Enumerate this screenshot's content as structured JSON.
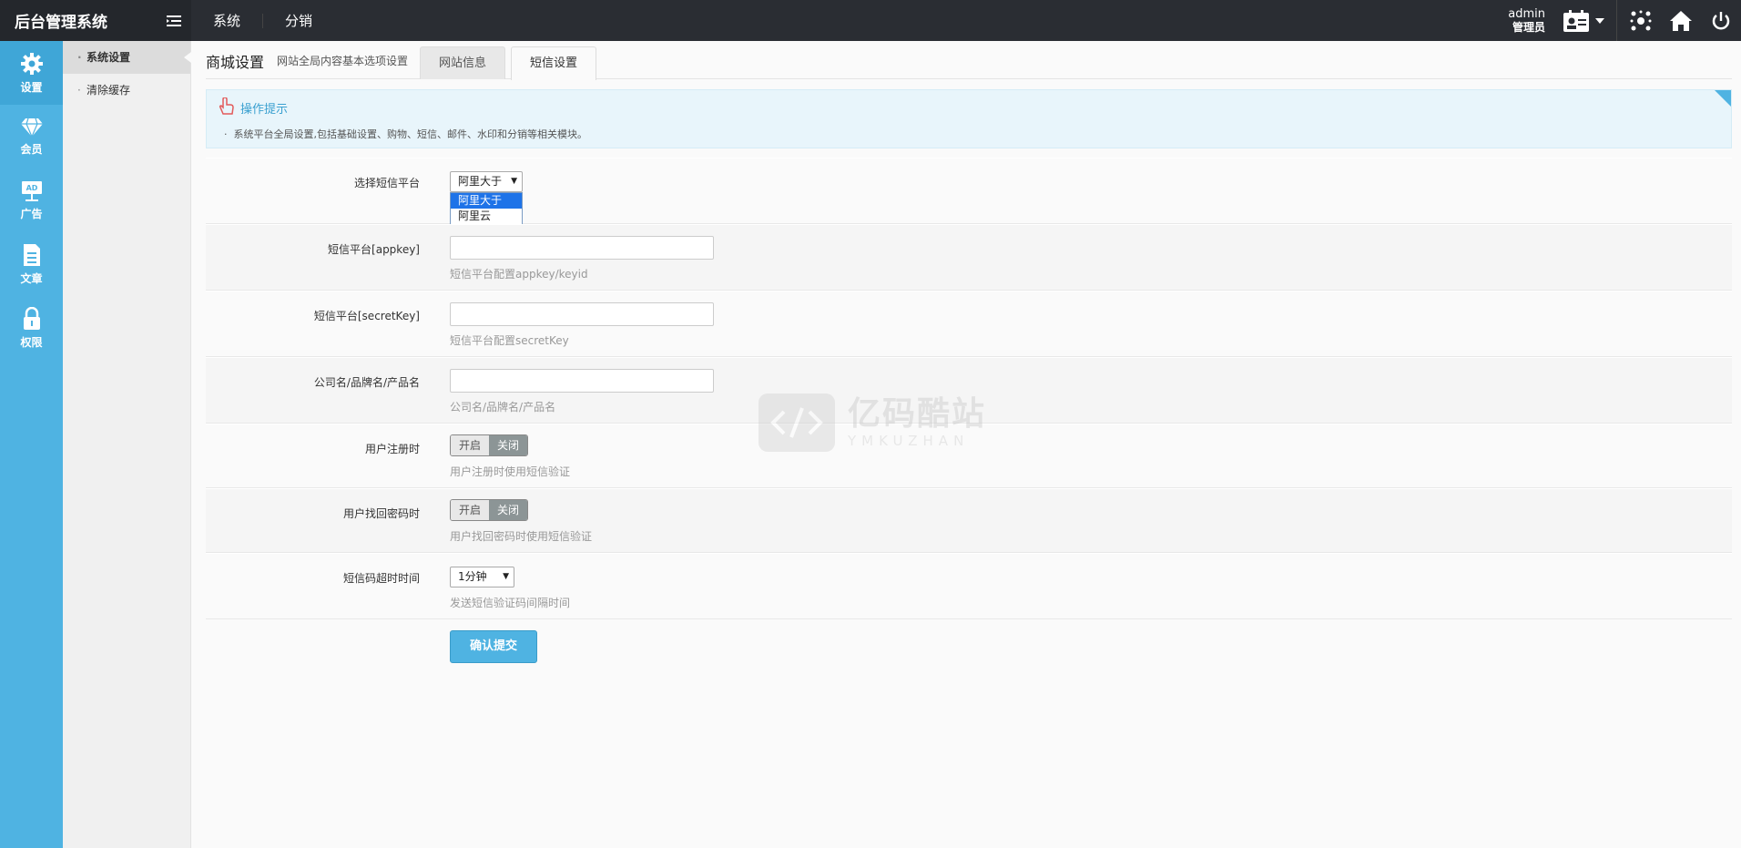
{
  "brand": {
    "title": "后台管理系统"
  },
  "top_nav": {
    "items": [
      "系统",
      "分销"
    ]
  },
  "user": {
    "name": "admin",
    "role": "管理员"
  },
  "iconbar": {
    "items": [
      {
        "label": "设置",
        "icon": "gear-icon"
      },
      {
        "label": "会员",
        "icon": "diamond-icon"
      },
      {
        "label": "广告",
        "icon": "ad-board-icon"
      },
      {
        "label": "文章",
        "icon": "document-icon"
      },
      {
        "label": "权限",
        "icon": "lock-icon"
      }
    ]
  },
  "submenu": {
    "items": [
      "系统设置",
      "清除缓存"
    ]
  },
  "page": {
    "title": "商城设置",
    "subtitle": "网站全局内容基本选项设置",
    "tabs": [
      "网站信息",
      "短信设置"
    ]
  },
  "tips": {
    "title": "操作提示",
    "text": "系统平台全局设置,包括基础设置、购物、短信、邮件、水印和分销等相关模块。"
  },
  "form": {
    "platform": {
      "label": "选择短信平台",
      "value": "阿里大于",
      "options": [
        "阿里大于",
        "阿里云"
      ]
    },
    "appkey": {
      "label": "短信平台[appkey]",
      "value": "",
      "hint": "短信平台配置appkey/keyid"
    },
    "secretkey": {
      "label": "短信平台[secretKey]",
      "value": "",
      "hint": "短信平台配置secretKey"
    },
    "company": {
      "label": "公司名/品牌名/产品名",
      "value": "",
      "hint": "公司名/品牌名/产品名"
    },
    "register": {
      "label": "用户注册时",
      "on": "开启",
      "off": "关闭",
      "hint": "用户注册时使用短信验证"
    },
    "findpwd": {
      "label": "用户找回密码时",
      "on": "开启",
      "off": "关闭",
      "hint": "用户找回密码时使用短信验证"
    },
    "timeout": {
      "label": "短信码超时时间",
      "value": "1分钟",
      "hint": "发送短信验证码间隔时间"
    },
    "submit": "确认提交"
  },
  "watermark": {
    "main": "亿码酷站",
    "sub": "YMKUZHAN"
  },
  "colors": {
    "accent": "#4fb3e2",
    "topbar": "#2a2d33",
    "selected_option": "#1e73e8"
  }
}
